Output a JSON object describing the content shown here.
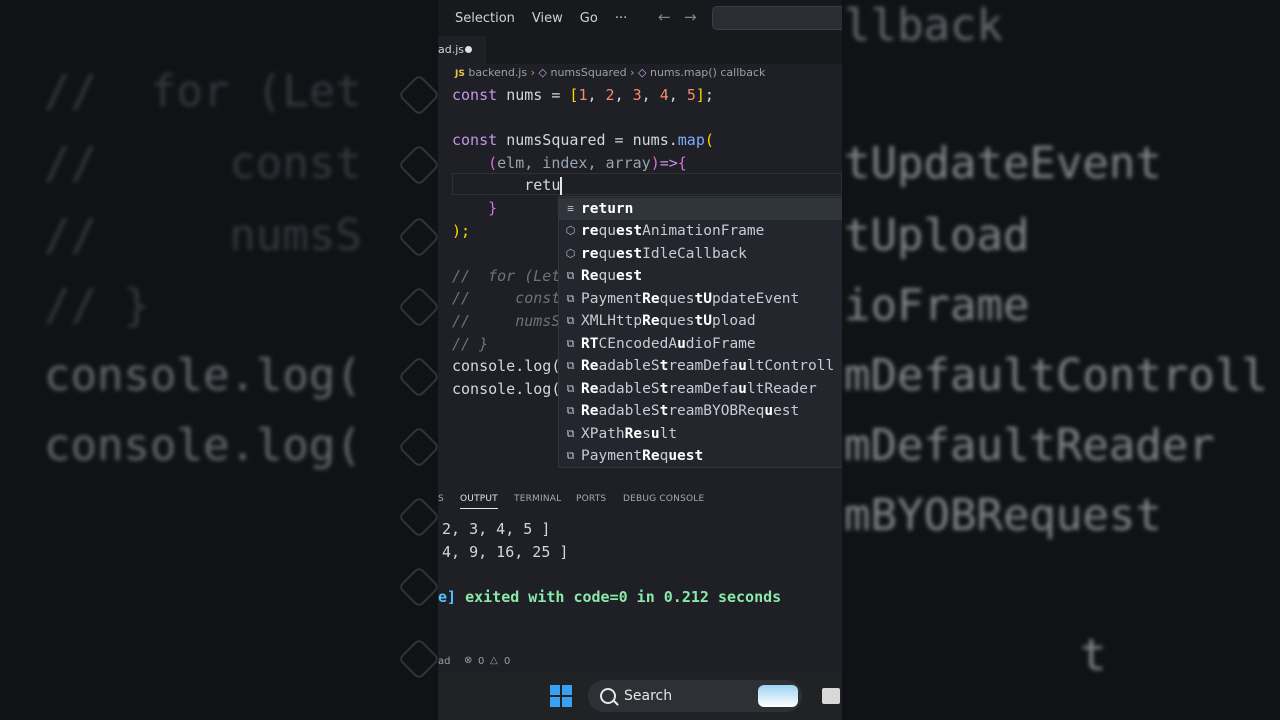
{
  "menu": {
    "selection": "Selection",
    "view": "View",
    "go": "Go",
    "more": "···",
    "back_icon": "arrow-left-icon",
    "forward_icon": "arrow-right-icon"
  },
  "tab": {
    "label": "ad.js"
  },
  "breadcrumb": {
    "lang": "JS",
    "file": "backend.js",
    "sym1": "numsSquared",
    "sym2": "nums.map() callback",
    "sep": "›"
  },
  "code": {
    "line1": {
      "kw": "const",
      "name": "nums",
      "eq": " = ",
      "open": "[",
      "v1": "1",
      "v2": "2",
      "v3": "3",
      "v4": "4",
      "v5": "5",
      "close": "]",
      "end": ";"
    },
    "line3": {
      "kw": "const",
      "name": "numsSquared",
      "eq": " = ",
      "obj": "nums",
      "dot": ".",
      "fn": "map",
      "paren": "("
    },
    "line4": {
      "open": "(",
      "params": "elm, index, array",
      "close": ")",
      "arrow": "=>",
      "brace": "{"
    },
    "line5": {
      "typed": "retu"
    },
    "line6": {
      "brace": "}"
    },
    "line7": {
      "text": ");"
    },
    "comment1": "//  for (Let",
    "comment2": "//     const",
    "comment3": "//     numsS",
    "comment4": "// }",
    "log1": "console.log(",
    "log2": "console.log("
  },
  "suggestions": [
    {
      "icon": "keyword-icon",
      "pre": "",
      "parts": [
        [
          "retu",
          true
        ],
        [
          "rn",
          true
        ]
      ]
    },
    {
      "icon": "method-icon",
      "pre": "",
      "parts": [
        [
          "re",
          true
        ],
        [
          "qu",
          false
        ],
        [
          "est",
          true
        ],
        [
          "AnimationFrame",
          false
        ]
      ]
    },
    {
      "icon": "method-icon",
      "pre": "",
      "parts": [
        [
          "re",
          true
        ],
        [
          "qu",
          false
        ],
        [
          "est",
          true
        ],
        [
          "IdleCallback",
          false
        ]
      ]
    },
    {
      "icon": "variable-icon",
      "pre": "",
      "parts": [
        [
          "Re",
          true
        ],
        [
          "qu",
          false
        ],
        [
          "est",
          true
        ]
      ]
    },
    {
      "icon": "variable-icon",
      "pre": "",
      "parts": [
        [
          "Payment",
          false
        ],
        [
          "Re",
          true
        ],
        [
          "ques",
          false
        ],
        [
          "tU",
          true
        ],
        [
          "pdateEvent",
          false
        ]
      ]
    },
    {
      "icon": "variable-icon",
      "pre": "",
      "parts": [
        [
          "XMLHttp",
          false
        ],
        [
          "Re",
          true
        ],
        [
          "ques",
          false
        ],
        [
          "tU",
          true
        ],
        [
          "pload",
          false
        ]
      ]
    },
    {
      "icon": "variable-icon",
      "pre": "",
      "parts": [
        [
          "R",
          true
        ],
        [
          "T",
          true
        ],
        [
          "CE",
          false
        ],
        [
          "ncoded",
          false
        ],
        [
          "A",
          false
        ],
        [
          "u",
          true
        ],
        [
          "dioFrame",
          false
        ]
      ]
    },
    {
      "icon": "variable-icon",
      "pre": "",
      "parts": [
        [
          "Re",
          true
        ],
        [
          "adableS",
          false
        ],
        [
          "t",
          true
        ],
        [
          "reamDefa",
          false
        ],
        [
          "u",
          true
        ],
        [
          "ltControll",
          false
        ]
      ]
    },
    {
      "icon": "variable-icon",
      "pre": "",
      "parts": [
        [
          "Re",
          true
        ],
        [
          "adableS",
          false
        ],
        [
          "t",
          true
        ],
        [
          "reamDef",
          false
        ],
        [
          "a",
          false
        ],
        [
          "u",
          true
        ],
        [
          "ltReader",
          false
        ]
      ]
    },
    {
      "icon": "variable-icon",
      "pre": "",
      "parts": [
        [
          "Re",
          true
        ],
        [
          "adableS",
          false
        ],
        [
          "t",
          true
        ],
        [
          "reamBYOBReq",
          false
        ],
        [
          "u",
          true
        ],
        [
          "est",
          false
        ]
      ]
    },
    {
      "icon": "variable-icon",
      "pre": "",
      "parts": [
        [
          "XPath",
          false
        ],
        [
          "Re",
          true
        ],
        [
          "s",
          false
        ],
        [
          "u",
          true
        ],
        [
          "lt",
          false
        ]
      ]
    },
    {
      "icon": "variable-icon",
      "pre": "",
      "parts": [
        [
          "Payment",
          false
        ],
        [
          "Re",
          true
        ],
        [
          "q",
          false
        ],
        [
          "u",
          true
        ],
        [
          "est",
          true
        ]
      ]
    }
  ],
  "panel": {
    "tabs": [
      "S",
      "OUTPUT",
      "TERMINAL",
      "PORTS",
      "DEBUG CONSOLE"
    ],
    "active": "OUTPUT"
  },
  "output": {
    "line1": "2, 3, 4, 5 ]",
    "line2": "4, 9, 16, 25 ]",
    "exit_prefix": "e]",
    "exit_text": " exited with code=0 in 0.212 seconds"
  },
  "status": {
    "left": "ad",
    "errors": "0",
    "warnings": "0"
  },
  "taskbar": {
    "search": "Search"
  },
  "background": {
    "l1": "//  for (Let",
    "l2": "//     const",
    "l3": "//     numsS",
    "l4": "// }",
    "l5": "console.log(",
    "l6": "console.log(",
    "r0": "llback",
    "r1": "tUpdateEvent",
    "r2": "tUpload",
    "r3": "ioFrame",
    "r4": "mDefaultControll",
    "r5": "mDefaultReader",
    "r6": "mBYOBRequest",
    "r7": "t"
  }
}
